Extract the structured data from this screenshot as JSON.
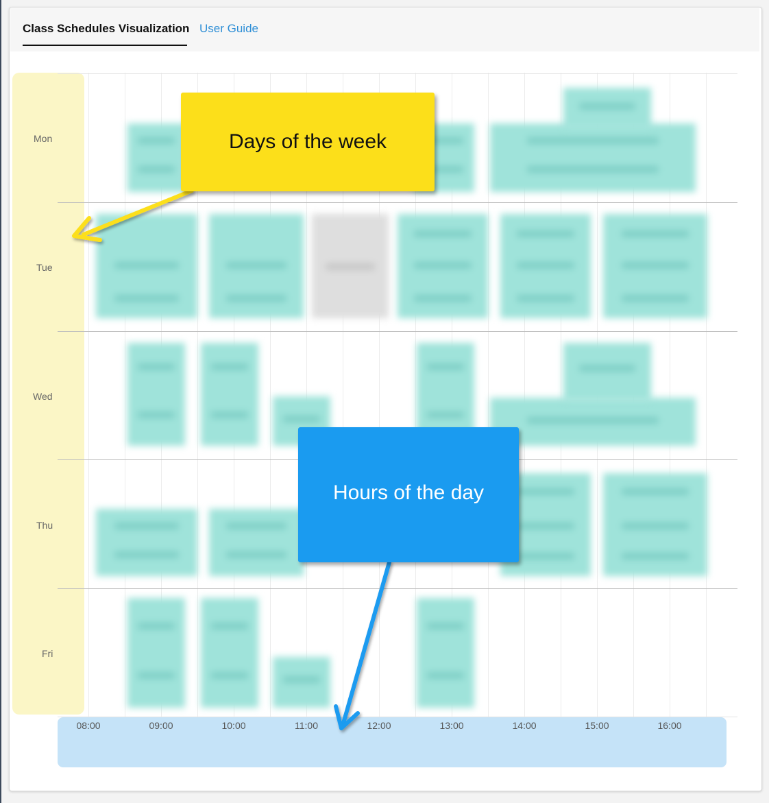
{
  "tabs": [
    {
      "label": "Class Schedules Visualization",
      "active": true
    },
    {
      "label": "User Guide",
      "active": false
    }
  ],
  "schedule": {
    "days": [
      "Mon",
      "Tue",
      "Wed",
      "Thu",
      "Fri"
    ],
    "hours": [
      "08:00",
      "09:00",
      "10:00",
      "11:00",
      "12:00",
      "13:00",
      "14:00",
      "15:00",
      "16:00"
    ]
  },
  "annotations": {
    "days_callout": "Days of the week",
    "hours_callout": "Hours of the day"
  },
  "colors": {
    "class_block": "#9fe3da",
    "unavailable_block": "#dedede",
    "days_highlight": "#fbf6c6",
    "hours_highlight": "#c5e3f8",
    "days_callout_bg": "#fcdf1a",
    "hours_callout_bg": "#1a9bf0"
  }
}
